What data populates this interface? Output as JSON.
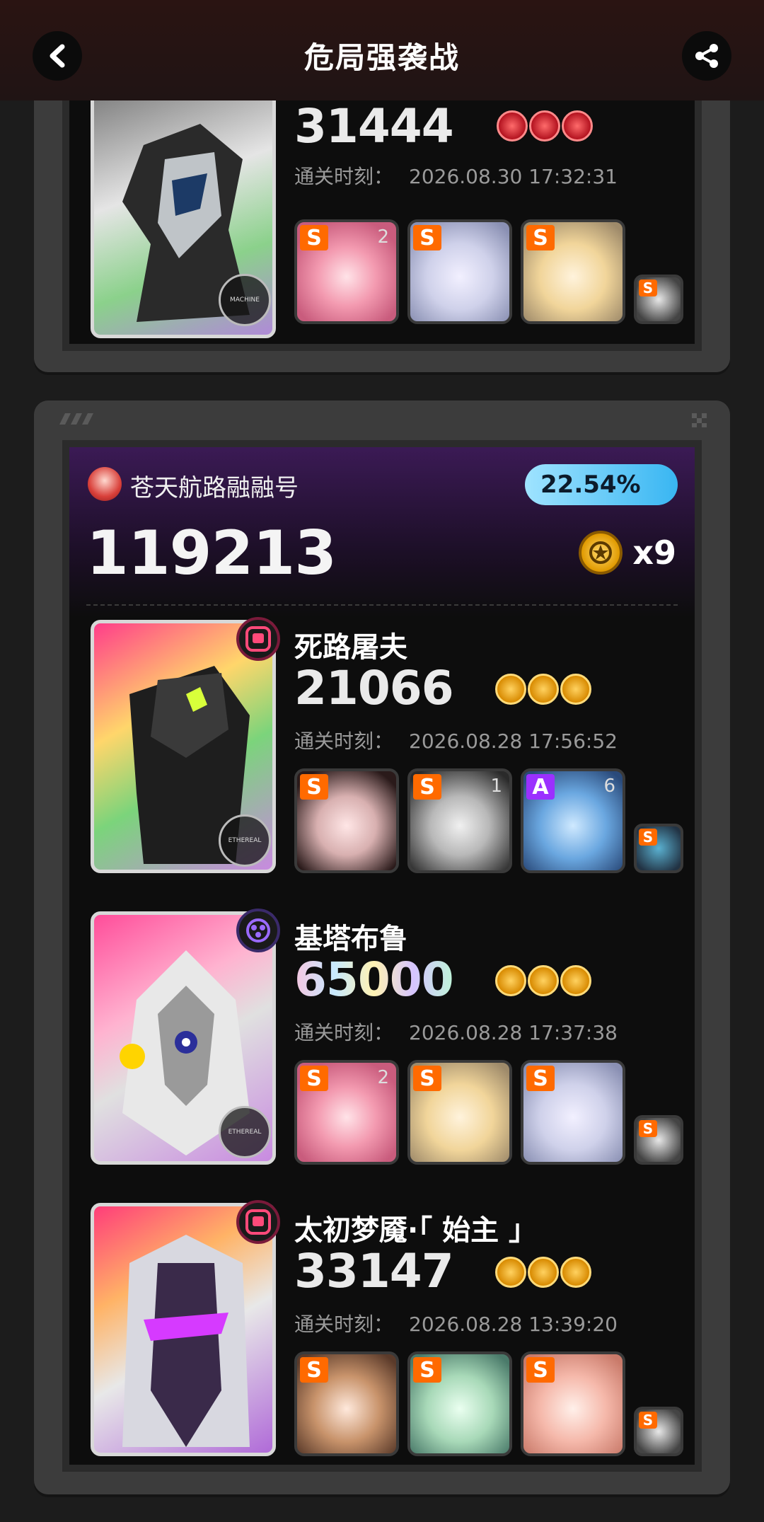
{
  "header": {
    "title": "危局强袭战"
  },
  "top_entry": {
    "score": "31444",
    "time_label": "通关时刻：",
    "time": "2026.08.30 17:32:31",
    "attribute": "MACHINE",
    "agents": [
      {
        "rank": "S",
        "mindscape": "2"
      },
      {
        "rank": "S",
        "mindscape": ""
      },
      {
        "rank": "S",
        "mindscape": ""
      }
    ],
    "bangboo_rank": "S"
  },
  "record": {
    "player_name": "苍天航路融融号",
    "percentile": "22.54%",
    "total_score": "119213",
    "coin_multiplier": "x9",
    "bosses": [
      {
        "name": "死路屠夫",
        "score": "21066",
        "medal": "gold",
        "time_label": "通关时刻：",
        "time": "2026.08.28 17:56:52",
        "attribute": "ETHEREAL",
        "agents": [
          {
            "rank": "S",
            "mindscape": ""
          },
          {
            "rank": "S",
            "mindscape": "1"
          },
          {
            "rank": "A",
            "mindscape": "6"
          }
        ],
        "bangboo_rank": "S"
      },
      {
        "name": "基塔布鲁",
        "score": "65000",
        "medal": "gold",
        "time_label": "通关时刻：",
        "time": "2026.08.28 17:37:38",
        "attribute": "ETHEREAL",
        "agents": [
          {
            "rank": "S",
            "mindscape": "2"
          },
          {
            "rank": "S",
            "mindscape": ""
          },
          {
            "rank": "S",
            "mindscape": ""
          }
        ],
        "bangboo_rank": "S"
      },
      {
        "name": "太初梦魇·「 始主 」",
        "score": "33147",
        "medal": "gold",
        "time_label": "通关时刻：",
        "time": "2026.08.28 13:39:20",
        "attribute": "",
        "agents": [
          {
            "rank": "S",
            "mindscape": ""
          },
          {
            "rank": "S",
            "mindscape": ""
          },
          {
            "rank": "S",
            "mindscape": ""
          }
        ],
        "bangboo_rank": "S"
      }
    ]
  },
  "colors": {
    "accent_orange": "#ff6a00",
    "rank_a": "#9b30ff",
    "percent_pill": "#39b6f2",
    "medal_gold": "#e09a00",
    "medal_red": "#b3121f"
  }
}
